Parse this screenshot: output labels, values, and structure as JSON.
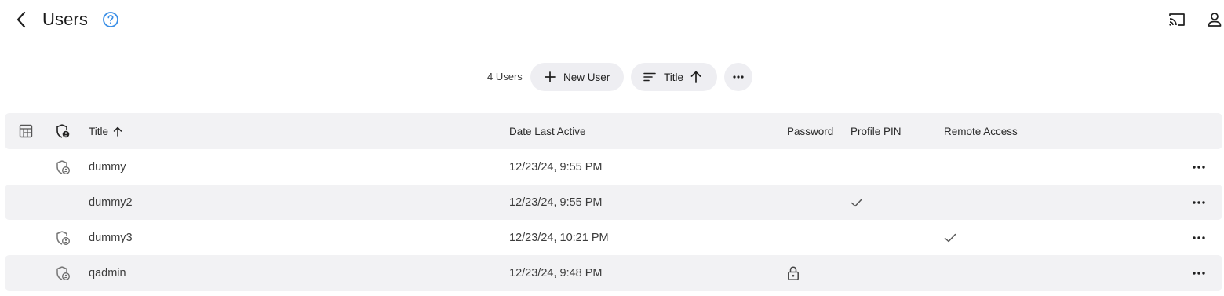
{
  "header": {
    "title": "Users",
    "back_icon": "chevron-left-icon",
    "help_icon": "help-circle-icon",
    "cast_icon": "cast-icon",
    "account_icon": "person-icon",
    "help_color": "#3a8ee6"
  },
  "toolbar": {
    "count_label": "4 Users",
    "new_user_label": "New User",
    "sort_label": "Title",
    "sort_direction": "ascending",
    "more_icon": "more-horizontal-icon"
  },
  "table": {
    "columns": {
      "select": "calculator-grid-icon",
      "role": "shield-user-icon",
      "title": "Title",
      "date": "Date Last Active",
      "password": "Password",
      "pin": "Profile PIN",
      "remote": "Remote Access"
    },
    "rows": [
      {
        "title": "dummy",
        "date": "12/23/24, 9:55 PM",
        "admin_icon": true,
        "password": false,
        "pin": false,
        "remote": false
      },
      {
        "title": "dummy2",
        "date": "12/23/24, 9:55 PM",
        "admin_icon": false,
        "password": false,
        "pin": true,
        "remote": false
      },
      {
        "title": "dummy3",
        "date": "12/23/24, 10:21 PM",
        "admin_icon": true,
        "password": false,
        "pin": false,
        "remote": true
      },
      {
        "title": "qadmin",
        "date": "12/23/24, 9:48 PM",
        "admin_icon": true,
        "password": true,
        "pin": false,
        "remote": false
      }
    ]
  }
}
